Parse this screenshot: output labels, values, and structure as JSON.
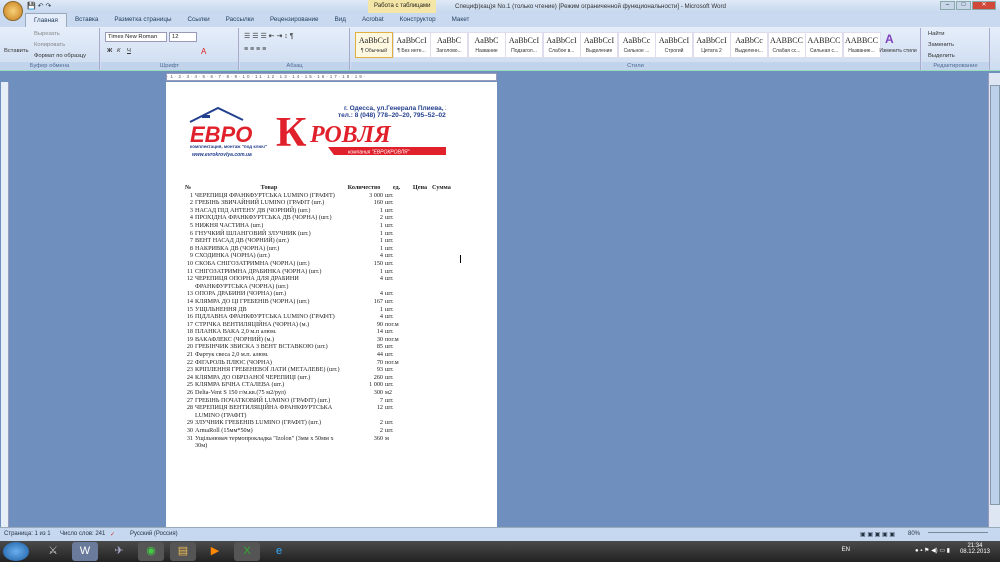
{
  "window": {
    "title": "Специф)кац)я No.1 (только чтение) [Режим ограниченной функциональности] - Microsoft Word",
    "context_tab": "Работа с таблицами"
  },
  "tabs": [
    "Главная",
    "Вставка",
    "Разметка страницы",
    "Ссылки",
    "Рассылки",
    "Рецензирование",
    "Вид",
    "Acrobat",
    "Конструктор",
    "Макет"
  ],
  "clipboard": {
    "paste": "Вставить",
    "cut": "Вырезать",
    "copy": "Копировать",
    "format_painter": "Формат по образцу",
    "group": "Буфер обмена"
  },
  "font": {
    "name": "Times New Roman",
    "size": "12",
    "group": "Шрифт",
    "bold": "Ж",
    "italic": "К",
    "underline": "Ч"
  },
  "paragraph": {
    "group": "Абзац"
  },
  "styles": {
    "group": "Стили",
    "change": "Изменить стили",
    "items": [
      {
        "preview": "AaBbCcI",
        "name": "¶ Обычный"
      },
      {
        "preview": "AaBbCcI",
        "name": "¶ Без инте..."
      },
      {
        "preview": "AaBbC",
        "name": "Заголово..."
      },
      {
        "preview": "AaBbC",
        "name": "Название"
      },
      {
        "preview": "AaBbCcI",
        "name": "Подзагол..."
      },
      {
        "preview": "AaBbCcI",
        "name": "Слабое в..."
      },
      {
        "preview": "AaBbCcI",
        "name": "Выделение"
      },
      {
        "preview": "AaBbCc",
        "name": "Сильное ..."
      },
      {
        "preview": "AaBbCcI",
        "name": "Строгий"
      },
      {
        "preview": "AaBbCcI",
        "name": "Цитата 2"
      },
      {
        "preview": "AaBbCc",
        "name": "Выделенн..."
      },
      {
        "preview": "AABBCC",
        "name": "Слабая сс..."
      },
      {
        "preview": "AABBCC",
        "name": "Сильная с..."
      },
      {
        "preview": "AABBCC",
        "name": "Название..."
      }
    ]
  },
  "editing": {
    "group": "Редактирование",
    "find": "Найти",
    "replace": "Заменить",
    "select": "Выделить"
  },
  "logo": {
    "euro": "ЕВРО",
    "k": "К",
    "rovlya": "РОВЛЯ",
    "address": "г. Одесса,  ул.Генерала Плиева, 2",
    "phone": "тел.: 8 (048) 778–20–20, 795–52–02",
    "slogan": "комплектация, монтаж \"под ключ\"",
    "site": "www.evrokrovlya.com.ua",
    "company": "компания \"ЕВРОКРОВЛЯ\""
  },
  "table": {
    "headers": [
      "№",
      "Товар",
      "Количество",
      "ед.",
      "Цена",
      "Сумма"
    ],
    "rows": [
      [
        "1",
        "ЧЕРЕПИЦЯ ФРАНКФУРТСЬКА LUMINO (ГРАФІТ)",
        "3 000",
        "шт."
      ],
      [
        "2",
        "ГРЕБІНЬ ЗВИЧАЙНИЙ LUMINO (ГРАФІТ (шт.)",
        "160",
        "шт."
      ],
      [
        "3",
        "НАСАД ПІД АНТЕНУ ДВ (ЧОРНИЙ) (шт.)",
        "1",
        "шт."
      ],
      [
        "4",
        "ПРОХІДНА ФРАНКФУРТСЬКА ДВ (ЧОРНА) (шт.)",
        "2",
        "шт."
      ],
      [
        "5",
        "НИЖНЯ ЧАСТИНА (шт.)",
        "1",
        "шт."
      ],
      [
        "6",
        "ГНУЧКИЙ ШЛАНГОВИЙ ЗЛУЧНИК (шт.)",
        "1",
        "шт."
      ],
      [
        "7",
        "ВЕНТ НАСАД ДВ (ЧОРНИЙ) (шт.)",
        "1",
        "шт."
      ],
      [
        "8",
        "НАКРИВКА ДВ (ЧОРНА) (шт.)",
        "1",
        "шт."
      ],
      [
        "9",
        "СХОДИНКА (ЧОРНА) (шт.)",
        "4",
        "шт."
      ],
      [
        "10",
        "СКОБА СНІГОЗАТРИМНА (ЧОРНА) (шт.)",
        "150",
        "шт."
      ],
      [
        "11",
        "СНІГОЗАТРИМНА ДРАБИНКА (ЧОРНА) (шт.)",
        "1",
        "шт."
      ],
      [
        "12",
        "ЧЕРЕПИЦЯ ОПОРНА ДЛЯ ДРАБИНИ ФРАНКФУРТСЬКА (ЧОРНА) (шт.)",
        "4",
        "шт."
      ],
      [
        "13",
        "ОПОРА ДРАБИНИ (ЧОРНА) (шт.)",
        "4",
        "шт."
      ],
      [
        "14",
        "КЛЯМРА ДО ЦІ ГРЕБЕНІВ (ЧОРНА) (шт.)",
        "167",
        "шт."
      ],
      [
        "15",
        "УЩІЛЬНЕННЯ ДВ",
        "1",
        "шт."
      ],
      [
        "16",
        "ПІДЛАВНА ФРАНКФУРТСЬКА LUMINO (ГРАФІТ)",
        "4",
        "шт."
      ],
      [
        "17",
        "СТРІЧКА ВЕНТИЛЯЦІЙНА (ЧОРНА) (м.)",
        "90",
        "пог.м"
      ],
      [
        "18",
        "ПЛАНКА ВАКА 2,0 м.п алюм.",
        "14",
        "шт."
      ],
      [
        "19",
        "ВАКАФЛЕКС (ЧОРНИЙ) (м.)",
        "30",
        "пог.м"
      ],
      [
        "20",
        "ГРЕБІНЧИК ЗВИСКА З ВЕНТ ВСТАВКОЮ (шт.)",
        "85",
        "шт."
      ],
      [
        "21",
        "Фартук свеса 2,0 м.п. алюм.",
        "44",
        "шт."
      ],
      [
        "22",
        "ФІГАРОЛЬ ПЛЮС (ЧОРНА)",
        "70",
        "пог.м"
      ],
      [
        "23",
        "КРІПЛЕННЯ ГРЕБЕНЕВОЇ ЛАТИ (МЕТАЛЕВЕ) (шт.)",
        "93",
        "шт."
      ],
      [
        "24",
        "КЛЯМРА ДО ОБРІЗАНОЇ ЧЕРЕПИЦІ (шт.)",
        "260",
        "шт."
      ],
      [
        "25",
        "КЛЯМРА БІЧНА СТАЛЕВА (шт.)",
        "1 000",
        "шт."
      ],
      [
        "26",
        "Delta-Vent S 150 г/м.кв.(75 м2/рул)",
        "300",
        "м2"
      ],
      [
        "27",
        "ГРЕБІНЬ ПОЧАТКОВИЙ LUMINO (ГРАФІТ) (шт.)",
        "7",
        "шт."
      ],
      [
        "28",
        "ЧЕРЕПИЦЯ ВЕНТИЛЯЦІЙНА ФРАНКФУРТСЬКА LUMINO (ГРАФІТ)",
        "12",
        "шт."
      ],
      [
        "29",
        "ЗЛУЧНИК ГРЕБЕНІВ LUMINO (ГРАФІТ) (шт.)",
        "2",
        "шт."
      ],
      [
        "30",
        "ArmaRoll (15мм*50м)",
        "2",
        "шт."
      ],
      [
        "31",
        "Ущільнювач термопрокладка \"Izolon\" (3мм х 50мм х 30м)",
        "360",
        "м"
      ]
    ]
  },
  "status": {
    "page": "Страница: 1 из 1",
    "words": "Число слов: 241",
    "language": "Русский (Россия)",
    "zoom": "80%"
  },
  "tray": {
    "lang": "EN",
    "time": "21:34",
    "date": "08.12.2013"
  },
  "colors": {
    "accent": "#e0202a",
    "ribbon": "#dbe6f4",
    "workspace": "#6f8fbf"
  }
}
